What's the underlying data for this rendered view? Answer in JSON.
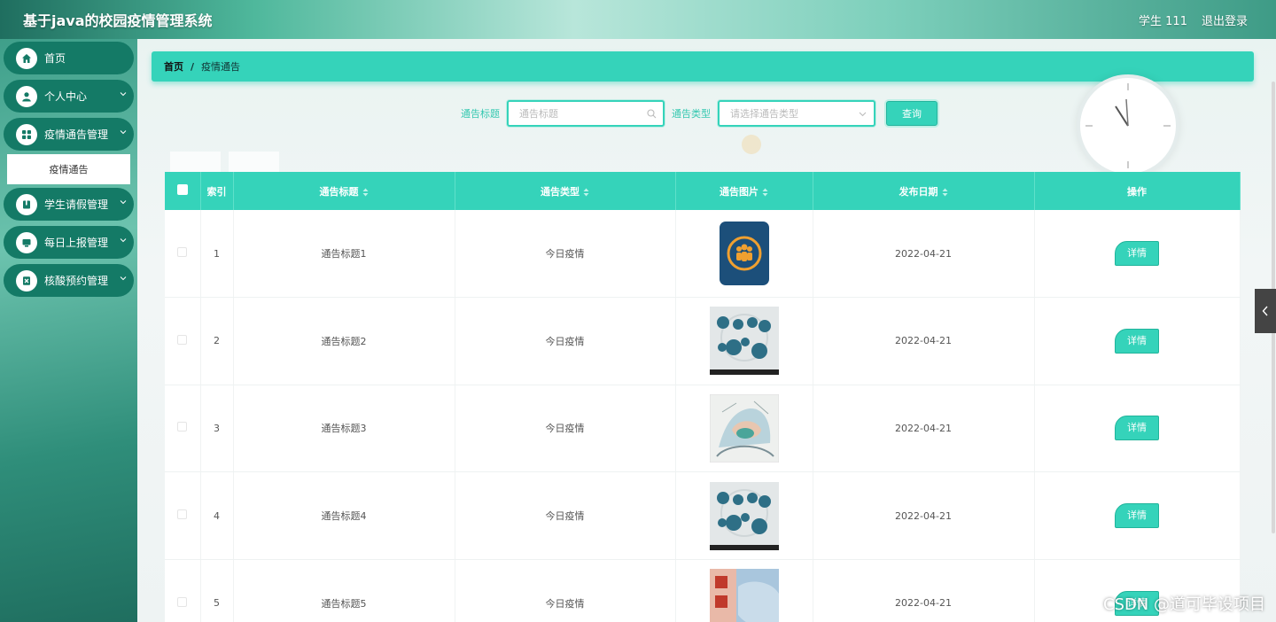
{
  "header": {
    "title": "基于java的校园疫情管理系统",
    "user_label": "学生 111",
    "logout_label": "退出登录"
  },
  "sidebar": {
    "items": [
      {
        "label": "首页",
        "icon": "home-icon",
        "has_arrow": false
      },
      {
        "label": "个人中心",
        "icon": "user-icon",
        "has_arrow": true
      },
      {
        "label": "疫情通告管理",
        "icon": "grid-icon",
        "has_arrow": true
      },
      {
        "label": "学生请假管理",
        "icon": "book-icon",
        "has_arrow": true
      },
      {
        "label": "每日上报管理",
        "icon": "report-icon",
        "has_arrow": true
      },
      {
        "label": "核酸预约管理",
        "icon": "excel-icon",
        "has_arrow": true
      }
    ],
    "submenu": {
      "label": "疫情通告"
    }
  },
  "breadcrumb": {
    "home": "首页",
    "separator": "/",
    "current": "疫情通告"
  },
  "search": {
    "title_label": "通告标题",
    "title_placeholder": "通告标题",
    "type_label": "通告类型",
    "type_placeholder": "请选择通告类型",
    "query_label": "查询"
  },
  "table": {
    "columns": [
      "",
      "索引",
      "通告标题",
      "通告类型",
      "通告图片",
      "发布日期",
      "操作"
    ],
    "rows": [
      {
        "index": "1",
        "title": "通告标题1",
        "type": "今日疫情",
        "image": "people-badge-image",
        "date": "2022-04-21",
        "action": "详情"
      },
      {
        "index": "2",
        "title": "通告标题2",
        "type": "今日疫情",
        "image": "medical-icons-image",
        "date": "2022-04-21",
        "action": "详情"
      },
      {
        "index": "3",
        "title": "通告标题3",
        "type": "今日疫情",
        "image": "doctor-sketch-image",
        "date": "2022-04-21",
        "action": "详情"
      },
      {
        "index": "4",
        "title": "通告标题4",
        "type": "今日疫情",
        "image": "medical-icons-image",
        "date": "2022-04-21",
        "action": "详情"
      },
      {
        "index": "5",
        "title": "通告标题5",
        "type": "今日疫情",
        "image": "mask-poster-image",
        "date": "2022-04-21",
        "action": "详情"
      }
    ]
  },
  "watermark": "CSDN @道可毕设项目",
  "colors": {
    "accent": "#35d3ba",
    "nav": "#147a66"
  }
}
